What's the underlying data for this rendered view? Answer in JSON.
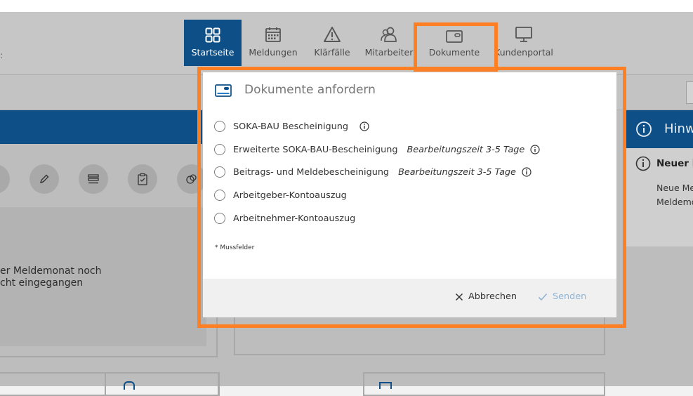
{
  "nav": {
    "items": [
      {
        "label": "Startseite"
      },
      {
        "label": "Meldungen"
      },
      {
        "label": "Klärfälle"
      },
      {
        "label": "Mitarbeiter"
      },
      {
        "label": "Dokumente"
      },
      {
        "label": "Kundenportal"
      }
    ]
  },
  "background": {
    "left_text_line1": "er Meldemonat noch",
    "left_text_line2": "cht eingegangen",
    "right_header": "Hinw",
    "right_item_title": "Neuer B",
    "right_item_line1": "Neue Me",
    "right_item_line2": "Meldemo"
  },
  "modal": {
    "title": "Dokumente anfordern",
    "options": [
      {
        "label": "SOKA-BAU Bescheinigung",
        "hint": "",
        "has_info": true
      },
      {
        "label": "Erweiterte SOKA-BAU-Bescheinigung",
        "hint": "Bearbeitungszeit 3-5 Tage",
        "has_info": true
      },
      {
        "label": "Beitrags- und Meldebescheinigung",
        "hint": "Bearbeitungszeit 3-5 Tage",
        "has_info": true
      },
      {
        "label": "Arbeitgeber-Kontoauszug",
        "hint": "",
        "has_info": false
      },
      {
        "label": "Arbeitnehmer-Kontoauszug",
        "hint": "",
        "has_info": false
      }
    ],
    "required_note": "* Mussfelder",
    "cancel_label": "Abbrechen",
    "send_label": "Senden"
  },
  "colors": {
    "primary": "#0d4f86",
    "highlight": "#ff7f24",
    "send_disabled": "#8fb4d6"
  }
}
